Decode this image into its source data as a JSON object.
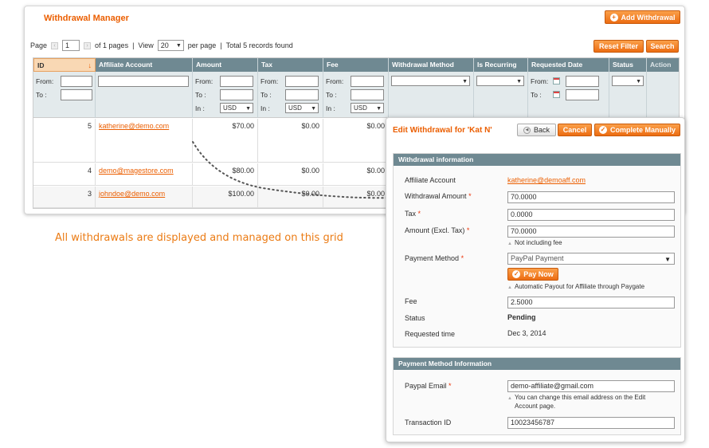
{
  "grid": {
    "title": "Withdrawal Manager",
    "add_button": "Add Withdrawal",
    "pager": {
      "page_label": "Page",
      "page_value": "1",
      "of_pages": "of 1 pages",
      "sep1": "|",
      "view_label": "View",
      "view_value": "20",
      "per_page": "per page",
      "sep2": "|",
      "records": "Total 5 records found"
    },
    "reset_filter": "Reset Filter",
    "search": "Search",
    "columns": [
      "ID",
      "Affiliate Account",
      "Amount",
      "Tax",
      "Fee",
      "Withdrawal Method",
      "Is Recurring",
      "Requested Date",
      "Status",
      "Action"
    ],
    "filters": {
      "from": "From:",
      "to": "To :",
      "in": "In :",
      "currency": "USD"
    },
    "rows": [
      {
        "id": "5",
        "account": "katherine@demo.com",
        "amount": "$70.00",
        "tax": "$0.00",
        "fee": "$0.00"
      },
      {
        "id": "4",
        "account": "demo@magestore.com",
        "amount": "$80.00",
        "tax": "$0.00",
        "fee": "$0.00"
      },
      {
        "id": "3",
        "account": "johndoe@demo.com",
        "amount": "$100.00",
        "tax": "$0.00",
        "fee": "$0.00"
      }
    ]
  },
  "caption": "All withdrawals are displayed and managed on this grid",
  "edit": {
    "title": "Edit Withdrawal for 'Kat N'",
    "back": "Back",
    "cancel": "Cancel",
    "complete": "Complete Manually",
    "withdrawal_info": {
      "legend": "Withdrawal information",
      "affiliate_label": "Affiliate Account",
      "affiliate_value": "katherine@demoaff.com",
      "amount_label": "Withdrawal Amount",
      "amount_value": "70.0000",
      "tax_label": "Tax",
      "tax_value": "0.0000",
      "excl_label": "Amount (Excl. Tax)",
      "excl_value": "70.0000",
      "excl_note": "Not including fee",
      "method_label": "Payment Method",
      "method_value": "PayPal Payment",
      "pay_now": "Pay Now",
      "pay_note": "Automatic Payout for Affiliate through Paygate",
      "fee_label": "Fee",
      "fee_value": "2.5000",
      "status_label": "Status",
      "status_value": "Pending",
      "requested_label": "Requested time",
      "requested_value": "Dec 3, 2014"
    },
    "payment_info": {
      "legend": "Payment Method Information",
      "email_label": "Paypal Email",
      "email_value": "demo-affiliate@gmail.com",
      "email_note_1": "You can change this email address on the Edit",
      "email_note_2": "Account page.",
      "txn_label": "Transaction ID",
      "txn_value": "10023456787"
    }
  },
  "colors": {
    "accent": "#eb5e00",
    "header_bg": "#6f8992",
    "filter_bg": "#e3eaec",
    "caption": "#eb7b14"
  }
}
